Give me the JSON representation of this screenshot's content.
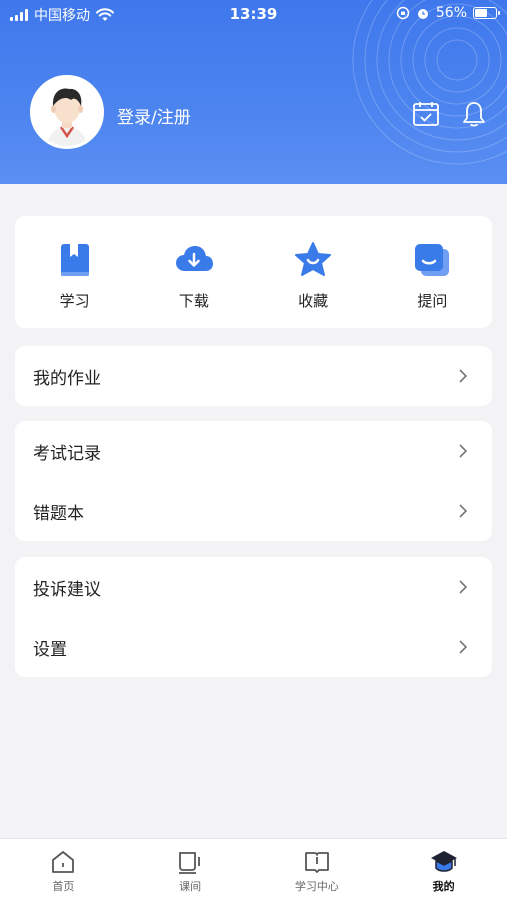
{
  "status_bar": {
    "carrier": "中国移动",
    "time": "13:39",
    "battery": "56%",
    "battery_level": 0.56
  },
  "header": {
    "login_label": "登录/注册",
    "icons": [
      "calendar-check-icon",
      "bell-icon"
    ]
  },
  "quick_actions": [
    {
      "label": "学习",
      "icon": "bookmark-book-icon"
    },
    {
      "label": "下载",
      "icon": "cloud-download-icon"
    },
    {
      "label": "收藏",
      "icon": "star-icon"
    },
    {
      "label": "提问",
      "icon": "question-card-icon"
    }
  ],
  "menu": {
    "homework": "我的作业",
    "exam_records": "考试记录",
    "wrong_book": "错题本",
    "complaints": "投诉建议",
    "settings": "设置"
  },
  "tabbar": {
    "tabs": [
      {
        "label": "首页",
        "icon": "home-icon"
      },
      {
        "label": "课间",
        "icon": "cup-icon"
      },
      {
        "label": "学习中心",
        "icon": "open-book-icon"
      },
      {
        "label": "我的",
        "icon": "graduation-cap-icon"
      }
    ],
    "active_index": 3
  },
  "colors": {
    "header_blue": "#3f78ec",
    "icon_blue": "#3a7bea",
    "background": "#f3f3f5"
  }
}
